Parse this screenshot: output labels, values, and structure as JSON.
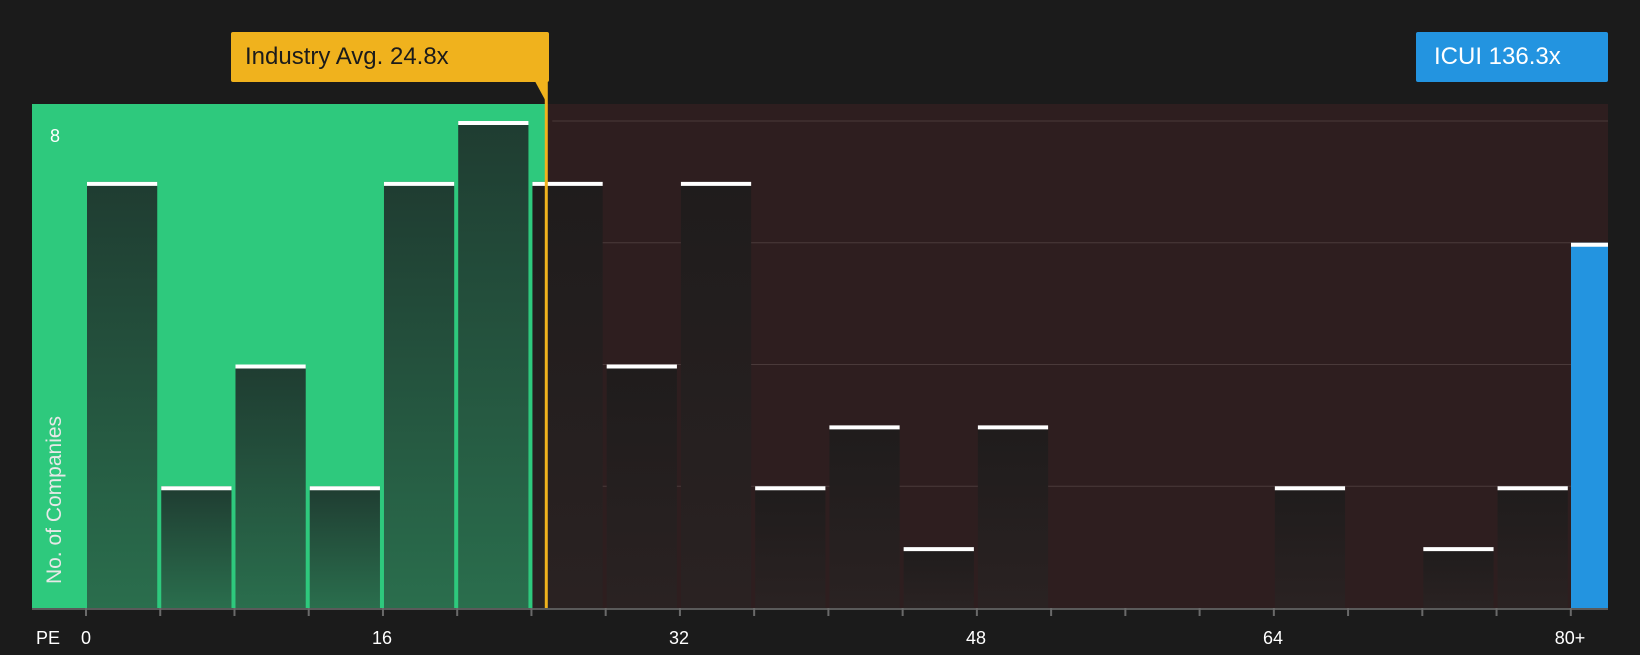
{
  "chart_data": {
    "type": "bar",
    "xlabel": "PE",
    "ylabel": "No. of Companies",
    "ylim": [
      0,
      8
    ],
    "y_ticks_labeled": [
      8
    ],
    "x_ticks": [
      "0",
      "16",
      "32",
      "48",
      "64",
      "80+"
    ],
    "bin_width": 4,
    "bins": [
      {
        "start": 0,
        "value": 7
      },
      {
        "start": 4,
        "value": 2
      },
      {
        "start": 8,
        "value": 4
      },
      {
        "start": 12,
        "value": 2
      },
      {
        "start": 16,
        "value": 7
      },
      {
        "start": 20,
        "value": 8
      },
      {
        "start": 24,
        "value": 7
      },
      {
        "start": 28,
        "value": 4
      },
      {
        "start": 32,
        "value": 7
      },
      {
        "start": 36,
        "value": 2
      },
      {
        "start": 40,
        "value": 3
      },
      {
        "start": 44,
        "value": 1
      },
      {
        "start": 48,
        "value": 3
      },
      {
        "start": 52,
        "value": 0
      },
      {
        "start": 56,
        "value": 0
      },
      {
        "start": 60,
        "value": 0
      },
      {
        "start": 64,
        "value": 2
      },
      {
        "start": 68,
        "value": 0
      },
      {
        "start": 72,
        "value": 1
      },
      {
        "start": 76,
        "value": 2
      }
    ],
    "company_bar_value": 6,
    "industry_avg": {
      "label": "Industry Avg. 24.8x",
      "value": 24.8
    },
    "company": {
      "label": "ICUI 136.3x",
      "value": 136.3
    },
    "colors": {
      "background": "#1b1b1b",
      "below_avg_region": "#2ec97d",
      "above_avg_region": "#2e1e1f",
      "bar_below": "#24473a",
      "bar_above": "#221e1e",
      "bar_top": "#ffffff",
      "industry_avg": "#f0b21d",
      "company": "#2394e0",
      "grid": "#4a3a3a"
    }
  }
}
